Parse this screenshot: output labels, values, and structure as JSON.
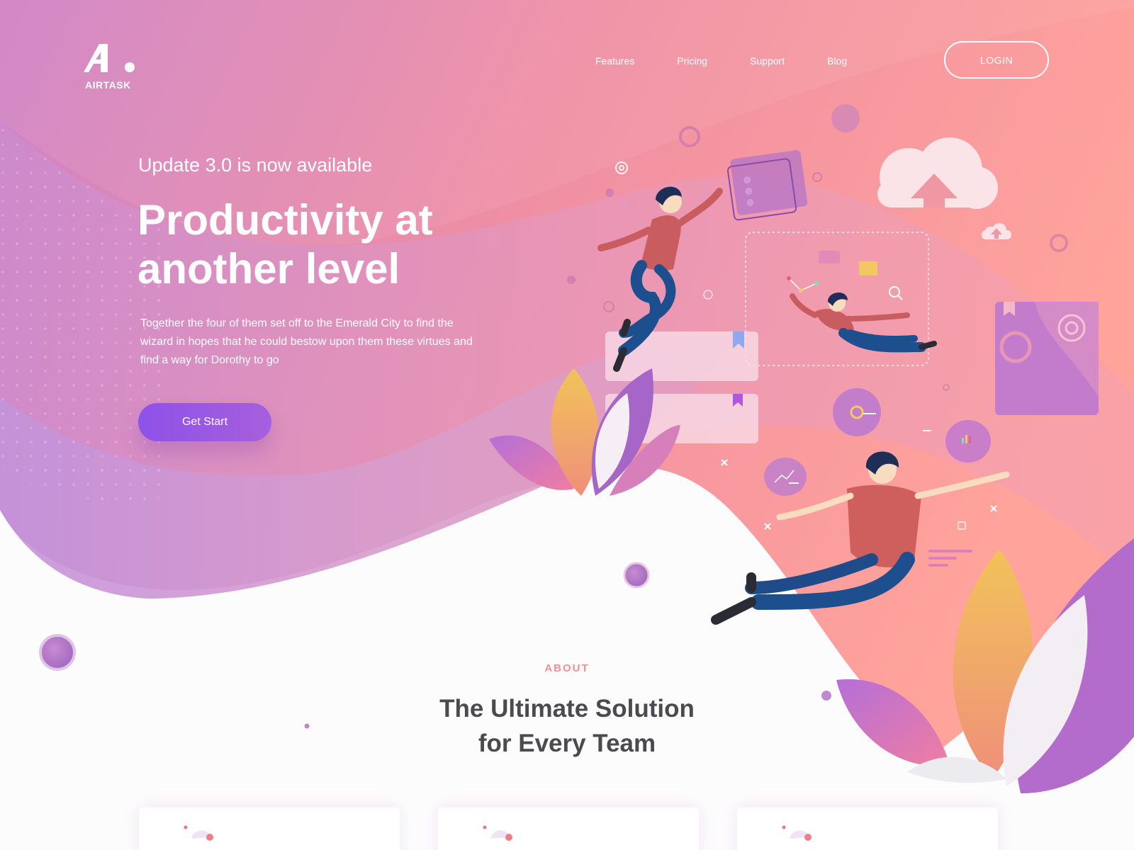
{
  "brand": {
    "name": "AIRTASK"
  },
  "nav": {
    "items": [
      "Features",
      "Pricing",
      "Support",
      "Blog"
    ],
    "login_label": "LOGIN"
  },
  "hero": {
    "subtitle": "Update 3.0 is now available",
    "title_line1": "Productivity at",
    "title_line2": "another level",
    "description": "Together the four of them set off to the Emerald City to find the wizard in hopes that he could bestow upon them these virtues and find a way for Dorothy to go",
    "cta_label": "Get Start"
  },
  "about": {
    "label": "ABOUT",
    "title_line1": "The Ultimate Solution",
    "title_line2": "for Every Team"
  },
  "feature_cards": [
    {
      "icon": "card-illustration-icon"
    },
    {
      "icon": "card-illustration-icon"
    },
    {
      "icon": "card-illustration-icon"
    }
  ],
  "colors": {
    "hero_gradient_start": "#c38ad3",
    "hero_gradient_end": "#ff9f98",
    "cta_gradient_start": "#8e52e8",
    "cta_gradient_end": "#a65fdd",
    "about_label": "#f19095",
    "about_title": "#4a4a4f"
  }
}
